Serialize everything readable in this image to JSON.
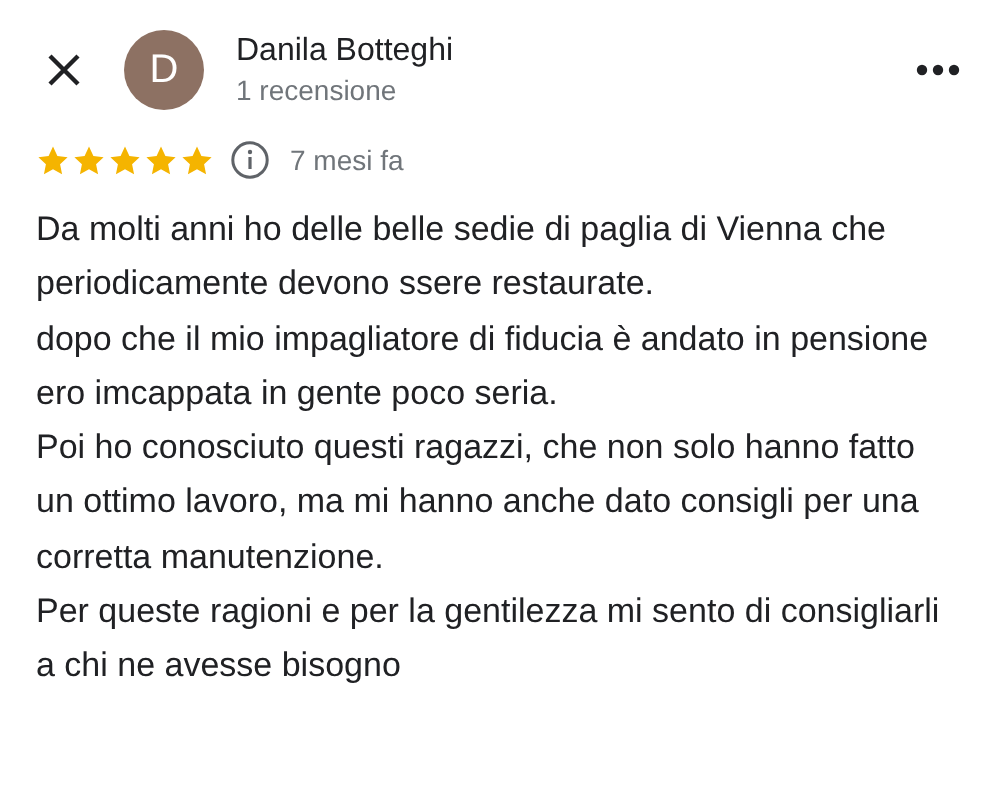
{
  "reviewer": {
    "initial": "D",
    "name": "Danila Botteghi",
    "review_count": "1 recensione"
  },
  "rating": {
    "stars": 5,
    "time": "7 mesi fa"
  },
  "paragraphs": [
    "Da molti anni ho delle belle sedie di paglia di Vienna che periodicamente devono ssere restaurate.",
    "dopo che il mio impagliatore di fiducia è andato in pensione ero imcappata in gente poco seria.",
    "Poi ho conosciuto questi ragazzi, che non solo hanno fatto un ottimo lavoro, ma mi hanno anche dato consigli per una corretta manutenzione.",
    "Per queste ragioni e per la gentilezza mi sento di consigliarli a chi ne avesse bisogno"
  ]
}
